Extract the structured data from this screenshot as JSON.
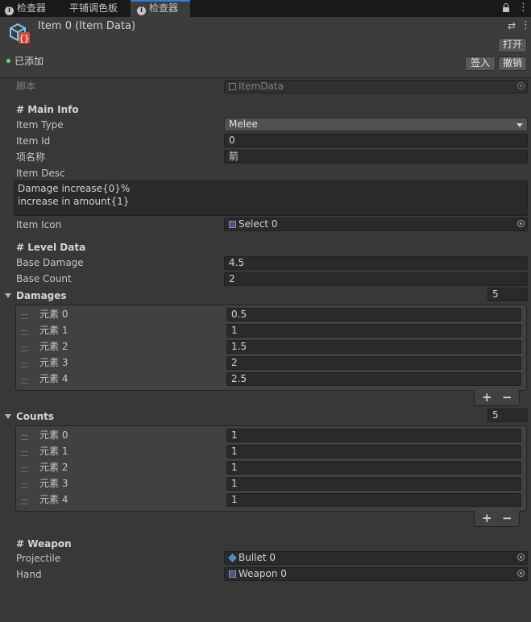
{
  "tabs": [
    {
      "label": "检查器"
    },
    {
      "label": "平铺调色板"
    },
    {
      "label": "检查器"
    }
  ],
  "header": {
    "title": "Item 0 (Item Data)",
    "open_label": "打开",
    "status": "已添加",
    "checkin_label": "签入",
    "revert_label": "撤销"
  },
  "script_row": {
    "label": "脚本",
    "value": "ItemData"
  },
  "main_info": {
    "heading": "# Main Info",
    "item_type": {
      "label": "Item Type",
      "value": "Melee"
    },
    "item_id": {
      "label": "Item Id",
      "value": "0"
    },
    "item_name": {
      "label": "项名称",
      "value": "箭"
    },
    "item_desc": {
      "label": "Item Desc",
      "line1": "Damage increase{0}%",
      "line2": "increase in amount{1}"
    },
    "item_icon": {
      "label": "Item Icon",
      "value": "Select 0"
    }
  },
  "level_data": {
    "heading": "# Level Data",
    "base_damage": {
      "label": "Base Damage",
      "value": "4.5"
    },
    "base_count": {
      "label": "Base Count",
      "value": "2"
    }
  },
  "damages": {
    "label": "Damages",
    "size": "5",
    "elements": [
      {
        "label": "元素 0",
        "value": "0.5"
      },
      {
        "label": "元素 1",
        "value": "1"
      },
      {
        "label": "元素 2",
        "value": "1.5"
      },
      {
        "label": "元素 3",
        "value": "2"
      },
      {
        "label": "元素 4",
        "value": "2.5"
      }
    ]
  },
  "counts": {
    "label": "Counts",
    "size": "5",
    "elements": [
      {
        "label": "元素 0",
        "value": "1"
      },
      {
        "label": "元素 1",
        "value": "1"
      },
      {
        "label": "元素 2",
        "value": "1"
      },
      {
        "label": "元素 3",
        "value": "1"
      },
      {
        "label": "元素 4",
        "value": "1"
      }
    ]
  },
  "list_controls": {
    "plus": "+",
    "minus": "−"
  },
  "weapon": {
    "heading": "# Weapon",
    "projectile": {
      "label": "Projectile",
      "value": "Bullet 0"
    },
    "hand": {
      "label": "Hand",
      "value": "Weapon 0"
    }
  },
  "colors": {
    "accent": "#3a79bb",
    "background": "#383838",
    "field": "#2a2a2a"
  },
  "icons": [
    "info-icon",
    "lock-icon",
    "kebab-menu-icon",
    "scriptable-object-icon",
    "object-picker-icon",
    "prefab-icon",
    "drag-handle-icon",
    "foldout-arrow-icon"
  ]
}
